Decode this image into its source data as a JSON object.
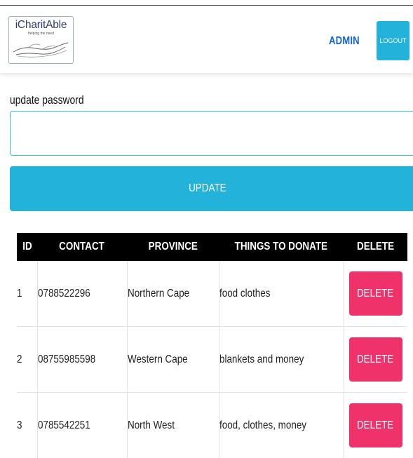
{
  "navbar": {
    "logo_text": "iCharitAble",
    "logo_tagline": "helping the need",
    "admin_label": "ADMIN",
    "logout_label": "LOGOUT"
  },
  "form": {
    "label": "update password",
    "password_value": "",
    "update_label": "UPDATE"
  },
  "table": {
    "headers": [
      "ID",
      "CONTACT",
      "PROVINCE",
      "THINGS TO DONATE",
      "DELETE"
    ],
    "rows": [
      {
        "id": "1",
        "contact": "0788522296",
        "province": "Northern Cape",
        "donate": "food clothes",
        "action": "DELETE"
      },
      {
        "id": "2",
        "contact": "08755985598",
        "province": "Western Cape",
        "donate": "blankets and money",
        "action": "DELETE"
      },
      {
        "id": "3",
        "contact": "0785542251",
        "province": "North West",
        "donate": "food, clothes, money",
        "action": "DELETE"
      }
    ]
  },
  "colors": {
    "accent": "#23b2d9",
    "admin_link": "#1565d8",
    "delete": "#f0326a",
    "table_header": "#000000"
  }
}
